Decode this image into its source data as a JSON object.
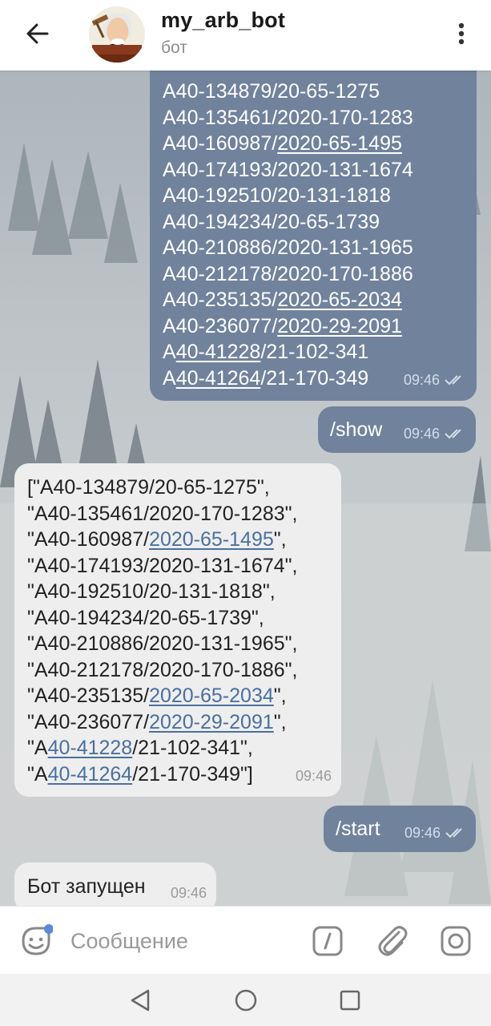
{
  "header": {
    "title": "my_arb_bot",
    "subtitle": "бот"
  },
  "messages": [
    {
      "direction": "out",
      "time": "09:46",
      "read": true,
      "lines": [
        [
          {
            "t": "А40-134879/20-65-1275"
          }
        ],
        [
          {
            "t": "А40-135461/2020-170-1283"
          }
        ],
        [
          {
            "t": "А40-160987/"
          },
          {
            "t": "2020-65-1495",
            "link": true
          }
        ],
        [
          {
            "t": "А40-174193/2020-131-1674"
          }
        ],
        [
          {
            "t": "А40-192510/20-131-1818"
          }
        ],
        [
          {
            "t": "А40-194234/20-65-1739"
          }
        ],
        [
          {
            "t": "А40-210886/2020-131-1965"
          }
        ],
        [
          {
            "t": "А40-212178/2020-170-1886"
          }
        ],
        [
          {
            "t": "А40-235135/"
          },
          {
            "t": "2020-65-2034",
            "link": true
          }
        ],
        [
          {
            "t": "А40-236077/"
          },
          {
            "t": "2020-29-2091",
            "link": true
          }
        ],
        [
          {
            "t": "А"
          },
          {
            "t": "40-41228",
            "link": true
          },
          {
            "t": "/21-102-341"
          }
        ],
        [
          {
            "t": "А"
          },
          {
            "t": "40-41264",
            "link": true
          },
          {
            "t": "/21-170-349"
          }
        ]
      ]
    },
    {
      "direction": "out",
      "time": "09:46",
      "read": true,
      "lines": [
        [
          {
            "t": "/show"
          }
        ]
      ]
    },
    {
      "direction": "in",
      "time": "09:46",
      "lines": [
        [
          {
            "t": "[\"А40-134879/20-65-1275\","
          }
        ],
        [
          {
            "t": "\"А40-135461/2020-170-1283\","
          }
        ],
        [
          {
            "t": "\"А40-160987/"
          },
          {
            "t": "2020-65-1495",
            "link": true
          },
          {
            "t": "\","
          }
        ],
        [
          {
            "t": "\"А40-174193/2020-131-1674\","
          }
        ],
        [
          {
            "t": "\"А40-192510/20-131-1818\","
          }
        ],
        [
          {
            "t": "\"А40-194234/20-65-1739\","
          }
        ],
        [
          {
            "t": "\"А40-210886/2020-131-1965\","
          }
        ],
        [
          {
            "t": "\"А40-212178/2020-170-1886\","
          }
        ],
        [
          {
            "t": "\"А40-235135/"
          },
          {
            "t": "2020-65-2034",
            "link": true
          },
          {
            "t": "\","
          }
        ],
        [
          {
            "t": "\"А40-236077/"
          },
          {
            "t": "2020-29-2091",
            "link": true
          },
          {
            "t": "\","
          }
        ],
        [
          {
            "t": "\"А"
          },
          {
            "t": "40-41228",
            "link": true
          },
          {
            "t": "/21-102-341\","
          }
        ],
        [
          {
            "t": "\"А"
          },
          {
            "t": "40-41264",
            "link": true
          },
          {
            "t": "/21-170-349\"]"
          }
        ]
      ]
    },
    {
      "direction": "out",
      "time": "09:46",
      "read": true,
      "lines": [
        [
          {
            "t": "/start"
          }
        ]
      ]
    },
    {
      "direction": "in",
      "time": "09:46",
      "lines": [
        [
          {
            "t": "Бот запущен"
          }
        ]
      ]
    }
  ],
  "input": {
    "placeholder": "Сообщение"
  },
  "colors": {
    "outgoing_bubble": "#71829d",
    "incoming_bubble": "#eeeeee",
    "link_incoming": "#4a6fa0",
    "background": "#b8c0c6"
  },
  "icons": {
    "back": "arrow-left-icon",
    "menu": "more-vertical-icon",
    "emoji": "sticker-icon",
    "commands": "bot-command-icon",
    "attach": "paperclip-icon",
    "camera": "instagram-camera-icon",
    "read_status": "double-check-icon",
    "nav_back": "triangle-back-icon",
    "nav_home": "circle-home-icon",
    "nav_recent": "square-recent-icon"
  }
}
